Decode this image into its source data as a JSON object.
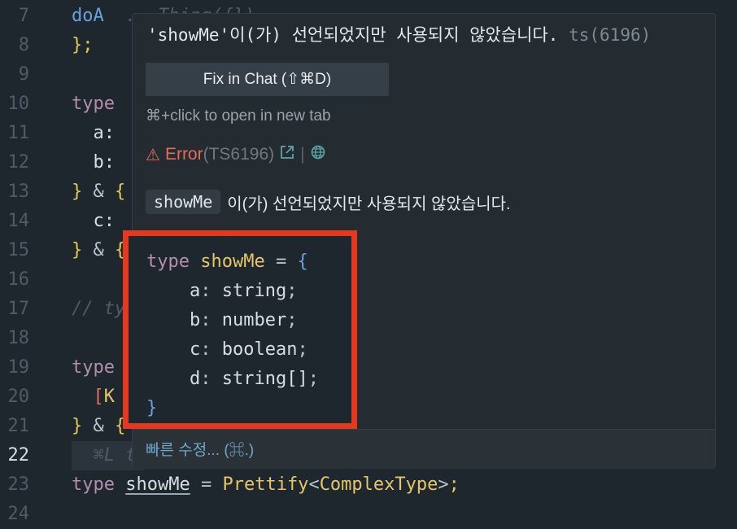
{
  "editor": {
    "lines": [
      {
        "n": "7",
        "tokens": [
          {
            "c": "fn",
            "t": "doA"
          },
          {
            "c": "cm",
            "t": "  ...Thing({}),"
          }
        ]
      },
      {
        "n": "8",
        "tokens": [
          {
            "c": "pu",
            "t": "};"
          }
        ]
      },
      {
        "n": "9",
        "tokens": []
      },
      {
        "n": "10",
        "tokens": [
          {
            "c": "kw",
            "t": "type"
          }
        ]
      },
      {
        "n": "11",
        "tokens": [
          {
            "c": "id",
            "t": "  a:"
          }
        ]
      },
      {
        "n": "12",
        "tokens": [
          {
            "c": "id",
            "t": "  b:"
          }
        ]
      },
      {
        "n": "13",
        "tokens": [
          {
            "c": "pu",
            "t": "} "
          },
          {
            "c": "op",
            "t": "& "
          },
          {
            "c": "pu",
            "t": "{"
          }
        ]
      },
      {
        "n": "14",
        "tokens": [
          {
            "c": "id",
            "t": "  c:"
          }
        ]
      },
      {
        "n": "15",
        "tokens": [
          {
            "c": "pu",
            "t": "} "
          },
          {
            "c": "op",
            "t": "& "
          },
          {
            "c": "pu",
            "t": "{"
          }
        ]
      },
      {
        "n": "16",
        "tokens": []
      },
      {
        "n": "17",
        "tokens": [
          {
            "c": "cm",
            "t": "// ty"
          }
        ]
      },
      {
        "n": "18",
        "tokens": []
      },
      {
        "n": "19",
        "tokens": [
          {
            "c": "kw",
            "t": "type"
          }
        ]
      },
      {
        "n": "20",
        "tokens": [
          {
            "c": "pr",
            "t": "  ["
          },
          {
            "c": "ty",
            "t": "K"
          }
        ]
      },
      {
        "n": "21",
        "tokens": [
          {
            "c": "pu",
            "t": "} "
          },
          {
            "c": "op",
            "t": "& "
          },
          {
            "c": "pu",
            "t": "{"
          }
        ]
      },
      {
        "n": "22",
        "tokens": [
          {
            "c": "cm",
            "t": "  ⌘L t"
          }
        ],
        "current": true
      },
      {
        "n": "23",
        "tokens": [
          {
            "c": "kw",
            "t": "type "
          },
          {
            "c": "id un",
            "t": "showMe"
          },
          {
            "c": "op",
            "t": " = "
          },
          {
            "c": "ty",
            "t": "Prettify"
          },
          {
            "c": "op",
            "t": "<"
          },
          {
            "c": "ty",
            "t": "ComplexType"
          },
          {
            "c": "op",
            "t": ">"
          },
          {
            "c": "pu",
            "t": ";"
          }
        ]
      },
      {
        "n": "24",
        "tokens": []
      }
    ]
  },
  "hover": {
    "message": "'showMe'이(가) 선언되었지만 사용되지 않았습니다.",
    "message_code": "ts(6196)",
    "fix_button": "Fix in Chat (⇧⌘D)",
    "hint": "⌘+click to open in new tab",
    "error_label": "Error",
    "error_code": "(TS6196)",
    "separator": "|",
    "desc_chip": "showMe",
    "desc_text": "이(가) 선언되었지만 사용되지 않았습니다.",
    "quick_fix": "빠른 수정... (⌘.)",
    "code_lines": [
      [
        {
          "c": "kw",
          "t": "type "
        },
        {
          "c": "ty",
          "t": "showMe"
        },
        {
          "c": "op",
          "t": " = "
        },
        {
          "c": "fn",
          "t": "{"
        }
      ],
      [
        {
          "c": "id",
          "t": "    a"
        },
        {
          "c": "op",
          "t": ": "
        },
        {
          "c": "id",
          "t": "string"
        },
        {
          "c": "op",
          "t": ";"
        }
      ],
      [
        {
          "c": "id",
          "t": "    b"
        },
        {
          "c": "op",
          "t": ": "
        },
        {
          "c": "id",
          "t": "number"
        },
        {
          "c": "op",
          "t": ";"
        }
      ],
      [
        {
          "c": "id",
          "t": "    c"
        },
        {
          "c": "op",
          "t": ": "
        },
        {
          "c": "id",
          "t": "boolean"
        },
        {
          "c": "op",
          "t": ";"
        }
      ],
      [
        {
          "c": "id",
          "t": "    d"
        },
        {
          "c": "op",
          "t": ": "
        },
        {
          "c": "id",
          "t": "string[]"
        },
        {
          "c": "op",
          "t": ";"
        }
      ],
      [
        {
          "c": "fn",
          "t": "}"
        }
      ]
    ]
  },
  "colors": {
    "background": "#1f272e",
    "highlight_box": "#e5381f",
    "error": "#e26d5c",
    "keyword": "#b48ead",
    "type": "#e6c56a"
  },
  "icons": [
    "warning-icon",
    "external-link-icon",
    "globe-icon"
  ]
}
